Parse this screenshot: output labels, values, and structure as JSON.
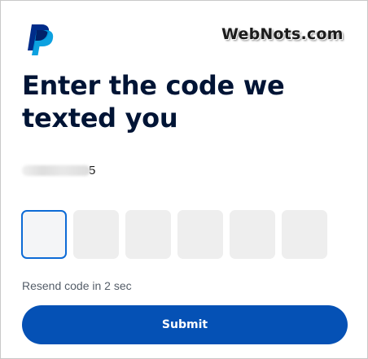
{
  "brand": {
    "logo_icon": "paypal-logo-icon",
    "watermark": "WebNots.com"
  },
  "heading": {
    "title": "Enter the code we texted you"
  },
  "phone": {
    "visible_suffix": "5"
  },
  "otp": {
    "length": 6,
    "values": [
      "",
      "",
      "",
      "",
      "",
      ""
    ],
    "active_index": 0
  },
  "resend": {
    "text": "Resend code in 2 sec"
  },
  "actions": {
    "submit_label": "Submit"
  },
  "colors": {
    "primary_button": "#0551b5",
    "focus_border": "#0d6bd6",
    "input_bg": "#eeeeee",
    "heading_text": "#001435",
    "secondary_text": "#545d68"
  }
}
